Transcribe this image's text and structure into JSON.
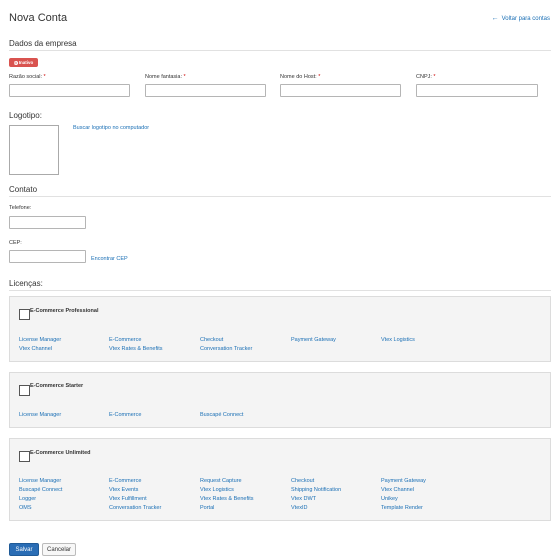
{
  "header": {
    "title": "Nova Conta",
    "back_arrow": "←",
    "back_link": "Voltar para contas"
  },
  "company": {
    "section_title": "Dados da empresa",
    "status_toggle": "Inativo",
    "fields": {
      "razao_social": "Razão social: ",
      "nome_fantasia": "Nome fantasia: ",
      "nome_host": "Nome do Host: ",
      "cnpj": "CNPJ: "
    },
    "required_mark": "*"
  },
  "logo": {
    "section_title": "Logotipo:",
    "upload_link": "Buscar logotipo no computador"
  },
  "contact": {
    "section_title": "Contato",
    "telefone_label": "Telefone:",
    "cep_label": "CEP:",
    "find_cep_link": "Encontrar CEP"
  },
  "licenses": {
    "section_title": "Licenças:",
    "plans": [
      {
        "name": "E-Commerce Professional",
        "checked": false,
        "links": [
          [
            "License Manager",
            "E-Commerce",
            "Checkout",
            "Payment Gateway",
            "Vtex Logistics"
          ],
          [
            "Vtex Channel",
            "Vtex Rates & Benefits",
            "Conversation Tracker"
          ]
        ]
      },
      {
        "name": "E-Commerce Starter",
        "checked": false,
        "links": [
          [
            "License Manager",
            "E-Commerce",
            "Buscapé Connect"
          ]
        ]
      },
      {
        "name": "E-Commerce Unlimited",
        "checked": false,
        "links": [
          [
            "License Manager",
            "E-Commerce",
            "Request Capture",
            "Checkout",
            "Payment Gateway"
          ],
          [
            "Buscapé Connect",
            "Vtex Events",
            "Vtex Logistics",
            "Shipping Notification",
            "Vtex Channel"
          ],
          [
            "Logger",
            "Vtex Fulfillment",
            "Vtex Rates & Benefits",
            "Vtex DWT",
            "Unikey"
          ],
          [
            "OMS",
            "Conversation Tracker",
            "Portal",
            "VtexID",
            "Template Render"
          ]
        ]
      }
    ]
  },
  "actions": {
    "save": "Salvar",
    "cancel": "Cancelar"
  },
  "colors": {
    "link": "#1a6fb5",
    "toggle_off": "#d9534f",
    "primary_button": "#2a6db5"
  }
}
